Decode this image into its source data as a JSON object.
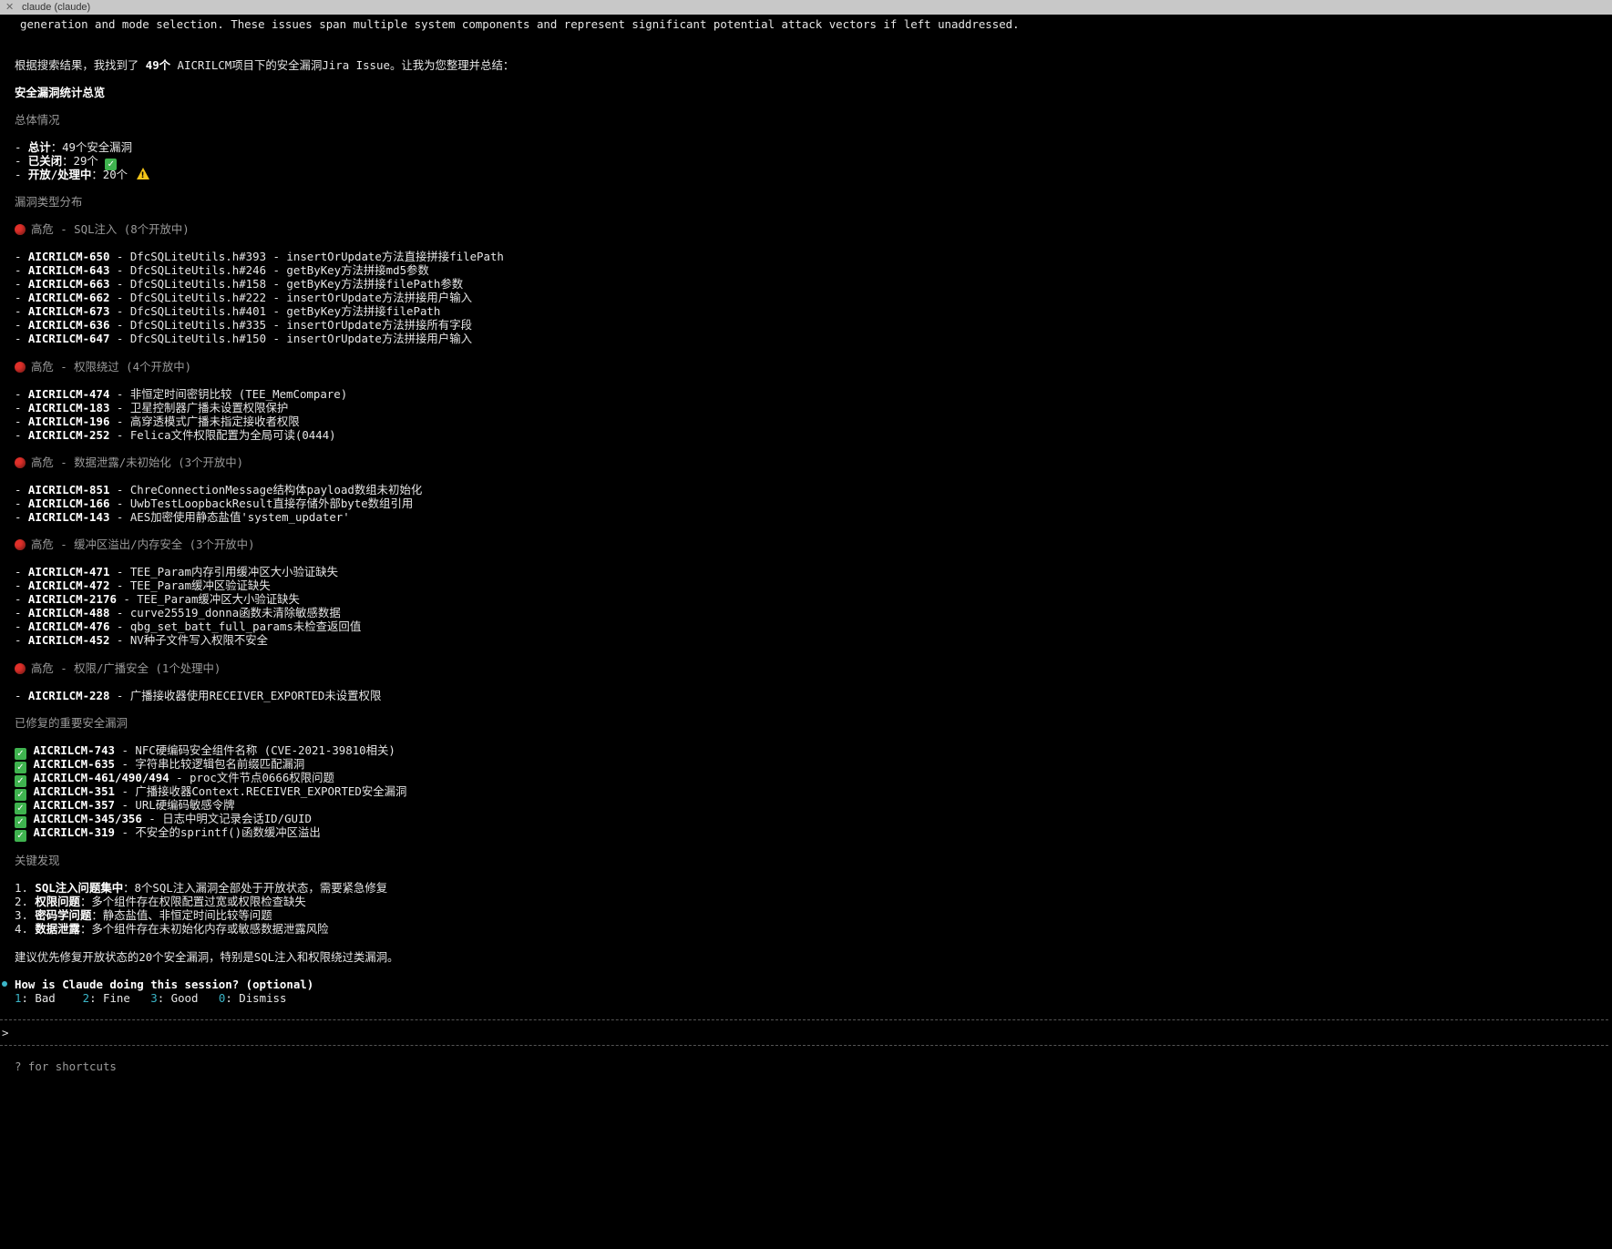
{
  "window": {
    "title": "claude (claude)"
  },
  "top_line": "generation and mode selection. These issues span multiple system components and represent significant potential attack vectors if left unaddressed.",
  "intro": {
    "pre": "根据搜索结果，我找到了 ",
    "count": "49个",
    "post": " AICRILCM项目下的安全漏洞Jira Issue。让我为您整理并总结："
  },
  "summary_title": "安全漏洞统计总览",
  "overall": {
    "heading": "总体情况",
    "items": [
      {
        "label": "总计",
        "value": "：49个安全漏洞"
      },
      {
        "label": "已关闭",
        "value": "：29个 "
      },
      {
        "label": "开放/处理中",
        "value": "：20个 "
      }
    ]
  },
  "distribution_heading": "漏洞类型分布",
  "groups": [
    {
      "heading": "高危 - SQL注入 (8个开放中)",
      "items": [
        {
          "id": "AICRILCM-650",
          "desc": " - DfcSQLiteUtils.h#393 - insertOrUpdate方法直接拼接filePath"
        },
        {
          "id": "AICRILCM-643",
          "desc": " - DfcSQLiteUtils.h#246 - getByKey方法拼接md5参数"
        },
        {
          "id": "AICRILCM-663",
          "desc": " - DfcSQLiteUtils.h#158 - getByKey方法拼接filePath参数"
        },
        {
          "id": "AICRILCM-662",
          "desc": " - DfcSQLiteUtils.h#222 - insertOrUpdate方法拼接用户输入"
        },
        {
          "id": "AICRILCM-673",
          "desc": " - DfcSQLiteUtils.h#401 - getByKey方法拼接filePath"
        },
        {
          "id": "AICRILCM-636",
          "desc": " - DfcSQLiteUtils.h#335 - insertOrUpdate方法拼接所有字段"
        },
        {
          "id": "AICRILCM-647",
          "desc": " - DfcSQLiteUtils.h#150 - insertOrUpdate方法拼接用户输入"
        }
      ]
    },
    {
      "heading": "高危 - 权限绕过 (4个开放中)",
      "items": [
        {
          "id": "AICRILCM-474",
          "desc": " - 非恒定时间密钥比较 (TEE_MemCompare)"
        },
        {
          "id": "AICRILCM-183",
          "desc": " - 卫星控制器广播未设置权限保护"
        },
        {
          "id": "AICRILCM-196",
          "desc": " - 高穿透模式广播未指定接收者权限"
        },
        {
          "id": "AICRILCM-252",
          "desc": " - Felica文件权限配置为全局可读(0444)"
        }
      ]
    },
    {
      "heading": "高危 - 数据泄露/未初始化 (3个开放中)",
      "items": [
        {
          "id": "AICRILCM-851",
          "desc": " - ChreConnectionMessage结构体payload数组未初始化"
        },
        {
          "id": "AICRILCM-166",
          "desc": " - UwbTestLoopbackResult直接存储外部byte数组引用"
        },
        {
          "id": "AICRILCM-143",
          "desc": " - AES加密使用静态盐值'system_updater'"
        }
      ]
    },
    {
      "heading": "高危 - 缓冲区溢出/内存安全 (3个开放中)",
      "items": [
        {
          "id": "AICRILCM-471",
          "desc": " - TEE_Param内存引用缓冲区大小验证缺失"
        },
        {
          "id": "AICRILCM-472",
          "desc": " - TEE_Param缓冲区验证缺失"
        },
        {
          "id": "AICRILCM-2176",
          "desc": " - TEE_Param缓冲区大小验证缺失"
        },
        {
          "id": "AICRILCM-488",
          "desc": " - curve25519_donna函数未清除敏感数据"
        },
        {
          "id": "AICRILCM-476",
          "desc": " - qbg_set_batt_full_params未检查返回值"
        },
        {
          "id": "AICRILCM-452",
          "desc": " - NV种子文件写入权限不安全"
        }
      ]
    },
    {
      "heading": "高危 - 权限/广播安全 (1个处理中)",
      "items": [
        {
          "id": "AICRILCM-228",
          "desc": " - 广播接收器使用RECEIVER_EXPORTED未设置权限"
        }
      ]
    }
  ],
  "fixed": {
    "heading": "已修复的重要安全漏洞",
    "items": [
      {
        "id": "AICRILCM-743",
        "desc": " - NFC硬编码安全组件名称 (CVE-2021-39810相关)"
      },
      {
        "id": "AICRILCM-635",
        "desc": " - 字符串比较逻辑包名前缀匹配漏洞"
      },
      {
        "id": "AICRILCM-461/490/494",
        "desc": " - proc文件节点0666权限问题"
      },
      {
        "id": "AICRILCM-351",
        "desc": " - 广播接收器Context.RECEIVER_EXPORTED安全漏洞"
      },
      {
        "id": "AICRILCM-357",
        "desc": " - URL硬编码敏感令牌"
      },
      {
        "id": "AICRILCM-345/356",
        "desc": " - 日志中明文记录会话ID/GUID"
      },
      {
        "id": "AICRILCM-319",
        "desc": " - 不安全的sprintf()函数缓冲区溢出"
      }
    ]
  },
  "findings": {
    "heading": "关键发现",
    "items": [
      {
        "num": "1. ",
        "label": "SQL注入问题集中",
        "desc": "：8个SQL注入漏洞全部处于开放状态，需要紧急修复"
      },
      {
        "num": "2. ",
        "label": "权限问题",
        "desc": "：多个组件存在权限配置过宽或权限检查缺失"
      },
      {
        "num": "3. ",
        "label": "密码学问题",
        "desc": "：静态盐值、非恒定时间比较等问题"
      },
      {
        "num": "4. ",
        "label": "数据泄露",
        "desc": "：多个组件存在未初始化内存或敏感数据泄露风险"
      }
    ]
  },
  "recommendation": "建议优先修复开放状态的20个安全漏洞，特别是SQL注入和权限绕过类漏洞。",
  "feedback": {
    "question": "How is Claude doing this session? (optional)",
    "options": [
      {
        "key": "1",
        "label": ": Bad"
      },
      {
        "key": "2",
        "label": ": Fine"
      },
      {
        "key": "3",
        "label": ": Good"
      },
      {
        "key": "0",
        "label": ": Dismiss"
      }
    ]
  },
  "input": {
    "prompt": ">",
    "value": ""
  },
  "footer_hint": "? for shortcuts",
  "colors": {
    "accent": "#3bb6c8",
    "critical": "#e0302a",
    "ok": "#3fb34f",
    "warn": "#f5c518"
  },
  "icons": {
    "close": "close-icon",
    "critical": "red-circle-icon",
    "ok": "check-mark-icon",
    "warn": "warning-icon"
  }
}
